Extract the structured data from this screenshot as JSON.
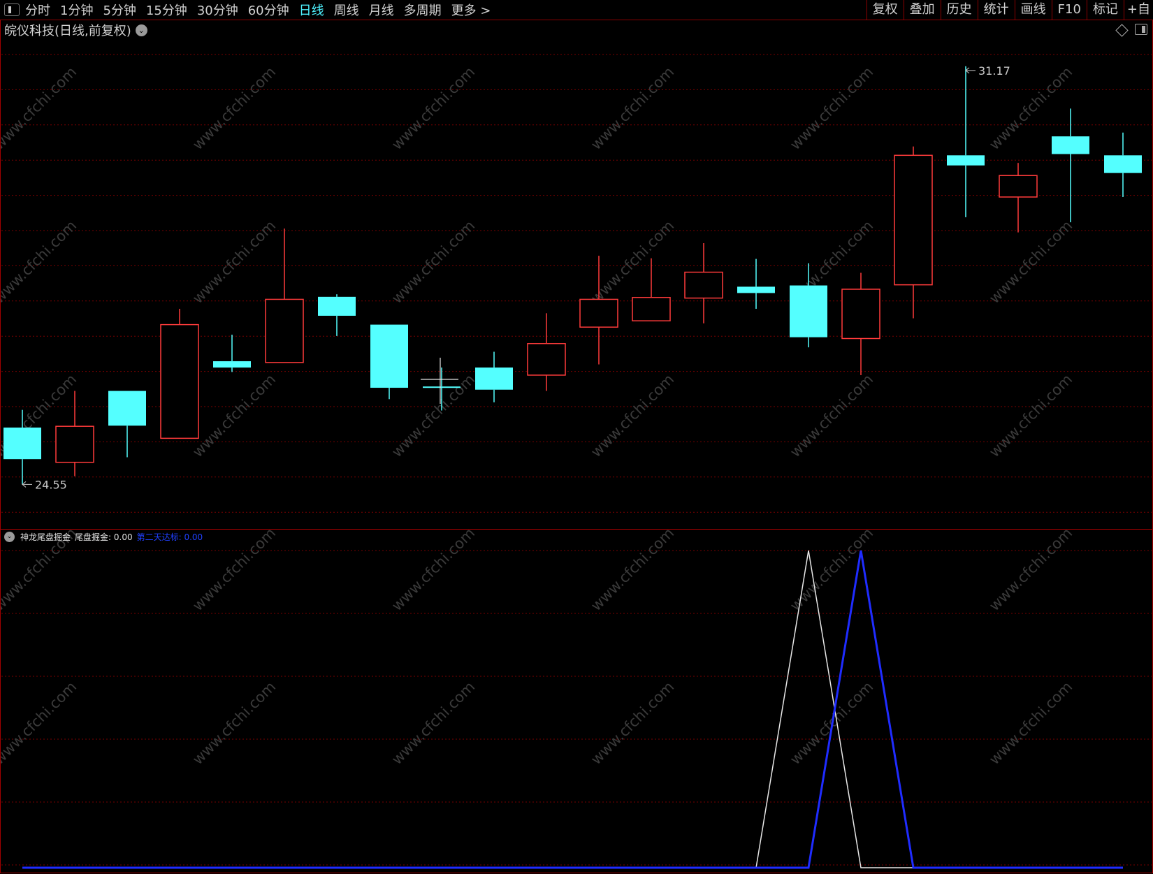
{
  "toolbar": {
    "periods": [
      "分时",
      "1分钟",
      "5分钟",
      "15分钟",
      "30分钟",
      "60分钟",
      "日线",
      "周线",
      "月线",
      "多周期",
      "更多 >"
    ],
    "active_period": "日线",
    "tools": [
      "复权",
      "叠加",
      "历史",
      "统计",
      "画线",
      "F10",
      "标记",
      "+自"
    ]
  },
  "stock_title": "皖仪科技(日线,前复权)",
  "indicator": {
    "name": "神龙尾盘掘金",
    "value1_text": "尾盘掘金: 0.00",
    "value2_text": "第二天达标: 0.00"
  },
  "watermark": "www.cfchi.com",
  "colors": {
    "up": "#ff3b3b",
    "down": "#54ffff",
    "line1": "#e8e8e8",
    "line2": "#1f2cff",
    "grid": "#7a0000"
  },
  "chart_data": [
    {
      "type": "candlestick",
      "title": "皖仪科技(日线,前复权)",
      "ylim": [
        24.2,
        31.5
      ],
      "annotations": [
        {
          "text": "31.17",
          "candle": 18,
          "kind": "high"
        },
        {
          "text": "24.55",
          "candle": 0,
          "kind": "low"
        }
      ],
      "candles": [
        {
          "open": 25.45,
          "close": 24.95,
          "high": 25.73,
          "low": 24.55
        },
        {
          "open": 24.9,
          "close": 25.47,
          "high": 26.03,
          "low": 24.68
        },
        {
          "open": 26.03,
          "close": 25.48,
          "high": 26.03,
          "low": 24.98
        },
        {
          "open": 25.28,
          "close": 27.08,
          "high": 27.33,
          "low": 25.28
        },
        {
          "open": 26.5,
          "close": 26.4,
          "high": 26.92,
          "low": 26.33
        },
        {
          "open": 26.48,
          "close": 27.48,
          "high": 28.6,
          "low": 26.48
        },
        {
          "open": 27.52,
          "close": 27.22,
          "high": 27.56,
          "low": 26.9
        },
        {
          "open": 27.08,
          "close": 26.08,
          "high": 27.08,
          "low": 25.9
        },
        {
          "open": 26.1,
          "close": 26.1,
          "high": 26.4,
          "low": 25.72
        },
        {
          "open": 26.4,
          "close": 26.05,
          "high": 26.65,
          "low": 25.85
        },
        {
          "open": 26.28,
          "close": 26.78,
          "high": 27.26,
          "low": 26.03
        },
        {
          "open": 27.04,
          "close": 27.48,
          "high": 28.17,
          "low": 26.45
        },
        {
          "open": 27.14,
          "close": 27.51,
          "high": 28.13,
          "low": 27.14
        },
        {
          "open": 27.5,
          "close": 27.91,
          "high": 28.37,
          "low": 27.1
        },
        {
          "open": 27.68,
          "close": 27.58,
          "high": 28.12,
          "low": 27.33
        },
        {
          "open": 27.7,
          "close": 26.88,
          "high": 28.05,
          "low": 26.72
        },
        {
          "open": 26.86,
          "close": 27.64,
          "high": 27.9,
          "low": 26.28
        },
        {
          "open": 27.71,
          "close": 29.76,
          "high": 29.9,
          "low": 27.18
        },
        {
          "open": 29.76,
          "close": 29.6,
          "high": 31.17,
          "low": 28.78
        },
        {
          "open": 29.1,
          "close": 29.44,
          "high": 29.64,
          "low": 28.54
        },
        {
          "open": 30.06,
          "close": 29.78,
          "high": 30.5,
          "low": 28.7
        },
        {
          "open": 29.76,
          "close": 29.48,
          "high": 30.12,
          "low": 29.1
        }
      ]
    },
    {
      "type": "line",
      "title": "神龙尾盘掘金",
      "ylim": [
        0,
        1
      ],
      "series": [
        {
          "name": "尾盘掘金",
          "color": "#e8e8e8",
          "values": [
            0,
            0,
            0,
            0,
            0,
            0,
            0,
            0,
            0,
            0,
            0,
            0,
            0,
            0,
            0,
            1,
            0,
            0,
            0,
            0,
            0,
            0
          ]
        },
        {
          "name": "第二天达标",
          "color": "#1f2cff",
          "values": [
            0,
            0,
            0,
            0,
            0,
            0,
            0,
            0,
            0,
            0,
            0,
            0,
            0,
            0,
            0,
            0,
            1,
            0,
            0,
            0,
            0,
            0
          ]
        }
      ]
    }
  ]
}
